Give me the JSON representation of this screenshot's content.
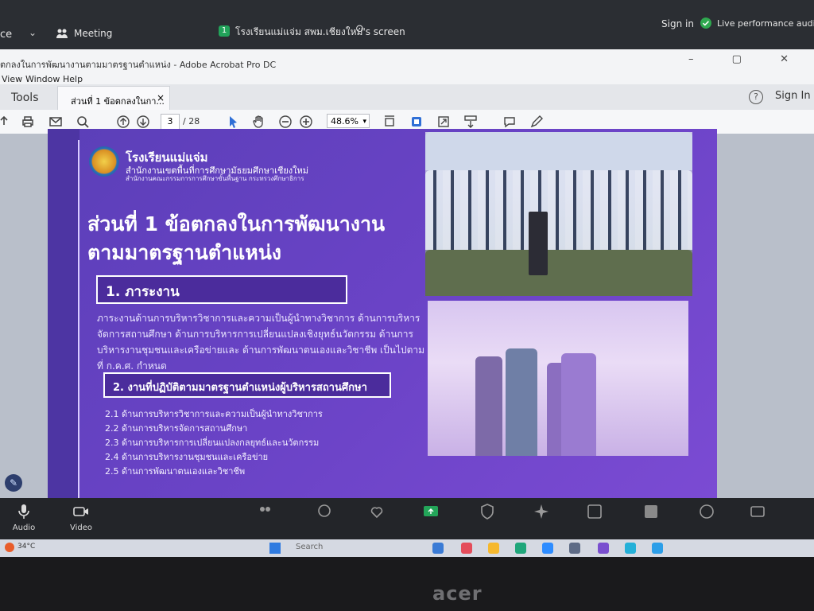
{
  "zoom_top": {
    "left_text": "ce",
    "meeting_label": "Meeting",
    "share_badge": "1",
    "share_title": "โรงเรียนแม่แจ่ม สพม.เชียงใหม่'s screen",
    "sign_in": "Sign in",
    "performance": "Live performance audio: on"
  },
  "acrobat": {
    "window_title": "ตกลงในการพัฒนางานตามมาตรฐานตำแหน่ง - Adobe Acrobat Pro DC",
    "menu": [
      "View",
      "Window",
      "Help"
    ],
    "tools_label": "Tools",
    "tab_label": "ส่วนที่ 1 ข้อตกลงในกา...",
    "tab_close": "×",
    "help_symbol": "?",
    "sign_in": "Sign In",
    "current_page": "3",
    "total_pages": "/ 28",
    "zoom_level": "48.6%"
  },
  "slide": {
    "school_name": "โรงเรียนแม่แจ่ม",
    "office_line1": "สำนักงานเขตพื้นที่การศึกษามัธยมศึกษาเชียงใหม่",
    "office_line2": "สำนักงานคณะกรรมการการศึกษาขั้นพื้นฐาน กระทรวงศึกษาธิการ",
    "headline_line1": "ส่วนที่ 1 ข้อตกลงในการพัฒนางาน",
    "headline_line2": "ตามมาตรฐานตำแหน่ง",
    "section1_title": "1. ภาระงาน",
    "section1_body": "ภาระงานด้านการบริหารวิชาการและความเป็นผู้นำทางวิชาการ ด้านการบริหารจัดการสถานศึกษา ด้านการบริหารการเปลี่ยนแปลงเชิงยุทธ์นวัตกรรม ด้านการบริหารงานชุมชนและเครือข่ายและ ด้านการพัฒนาตนเองและวิชาชีพ เป็นไปตามที่ ก.ค.ศ. กำหนด",
    "section2_title": "2. งานที่ปฏิบัติตามมาตรฐานตำแหน่งผู้บริหารสถานศึกษา",
    "duties": [
      "2.1 ด้านการบริหารวิชาการและความเป็นผู้นำทางวิชาการ",
      "2.2 ด้านการบริหารจัดการสถานศึกษา",
      "2.3 ด้านการบริหารการเปลี่ยนแปลงกลยุทธ์และนวัตกรรม",
      "2.4 ด้านการบริหารงานชุมชนและเครือข่าย",
      "2.5 ด้านการพัฒนาตนเองและวิชาชีพ"
    ]
  },
  "zoom_bottom": {
    "audio_label": "Audio",
    "video_label": "Video"
  },
  "taskbar": {
    "temp_text": "34°C",
    "search_text": "Search"
  },
  "monitor_brand": "acer"
}
